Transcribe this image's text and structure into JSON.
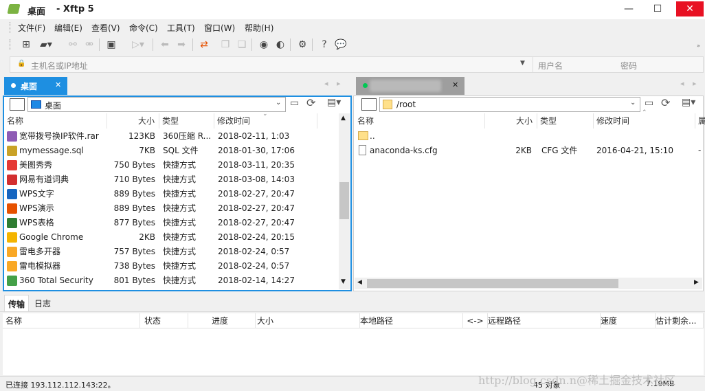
{
  "window": {
    "title_icon": "xftp-logo-icon",
    "title_location": "桌面",
    "title_app": "- Xftp 5",
    "minimize": "—",
    "maximize": "☐",
    "close": "✕"
  },
  "menu": [
    "文件(F)",
    "编辑(E)",
    "查看(V)",
    "命令(C)",
    "工具(T)",
    "窗口(W)",
    "帮助(H)"
  ],
  "address": {
    "host_placeholder": "主机名或IP地址",
    "user_placeholder": "用户名",
    "password_placeholder": "密码"
  },
  "local": {
    "tab_label": "桌面",
    "path": "桌面",
    "headers": [
      "名称",
      "大小",
      "类型",
      "修改时间"
    ],
    "files": [
      {
        "name": "宽带拨号换IP软件.rar",
        "size": "123KB",
        "type": "360压缩 R...",
        "mtime": "2018-02-11, 1:03",
        "icon": "rar-icon",
        "color": "#8e5bb5"
      },
      {
        "name": "mymessage.sql",
        "size": "7KB",
        "type": "SQL 文件",
        "mtime": "2018-01-30, 17:06",
        "icon": "sql-file-icon",
        "color": "#c9a227"
      },
      {
        "name": "美图秀秀",
        "size": "750 Bytes",
        "type": "快捷方式",
        "mtime": "2018-03-11, 20:35",
        "icon": "meitu-icon",
        "color": "#e53935"
      },
      {
        "name": "网易有道词典",
        "size": "710 Bytes",
        "type": "快捷方式",
        "mtime": "2018-03-08, 14:03",
        "icon": "youdao-icon",
        "color": "#d32f2f"
      },
      {
        "name": "WPS文字",
        "size": "889 Bytes",
        "type": "快捷方式",
        "mtime": "2018-02-27, 20:47",
        "icon": "wps-writer-icon",
        "color": "#1565c0"
      },
      {
        "name": "WPS演示",
        "size": "889 Bytes",
        "type": "快捷方式",
        "mtime": "2018-02-27, 20:47",
        "icon": "wps-presentation-icon",
        "color": "#e65100"
      },
      {
        "name": "WPS表格",
        "size": "877 Bytes",
        "type": "快捷方式",
        "mtime": "2018-02-27, 20:47",
        "icon": "wps-spreadsheet-icon",
        "color": "#2e7d32"
      },
      {
        "name": "Google Chrome",
        "size": "2KB",
        "type": "快捷方式",
        "mtime": "2018-02-24, 20:15",
        "icon": "chrome-icon",
        "color": "#f4b400"
      },
      {
        "name": "雷电多开器",
        "size": "757 Bytes",
        "type": "快捷方式",
        "mtime": "2018-02-24, 0:57",
        "icon": "leidian-multi-icon",
        "color": "#f9a825"
      },
      {
        "name": "雷电模拟器",
        "size": "738 Bytes",
        "type": "快捷方式",
        "mtime": "2018-02-24, 0:57",
        "icon": "leidian-emulator-icon",
        "color": "#f9a825"
      },
      {
        "name": "360 Total Security",
        "size": "801 Bytes",
        "type": "快捷方式",
        "mtime": "2018-02-14, 14:27",
        "icon": "360-security-icon",
        "color": "#43a047"
      }
    ]
  },
  "remote": {
    "path": "/root",
    "headers": [
      "名称",
      "大小",
      "类型",
      "修改时间",
      "属"
    ],
    "files": [
      {
        "name": "..",
        "size": "",
        "type": "",
        "mtime": "",
        "icon": "folder-icon"
      },
      {
        "name": "anaconda-ks.cfg",
        "size": "2KB",
        "type": "CFG 文件",
        "mtime": "2016-04-21, 15:10",
        "icon": "file-icon",
        "extra": "-"
      }
    ]
  },
  "transfer": {
    "tabs": [
      "传输",
      "日志"
    ],
    "headers": [
      "名称",
      "状态",
      "进度",
      "大小",
      "本地路径",
      "<->",
      "远程路径",
      "速度",
      "估计剩余..."
    ]
  },
  "status": {
    "connection": "已连接 193.112.112.143:22。",
    "objects": "45 对象",
    "size": "7.19MB",
    "watermark": "http://blog.csdn.n@稀土掘金技术社区"
  }
}
